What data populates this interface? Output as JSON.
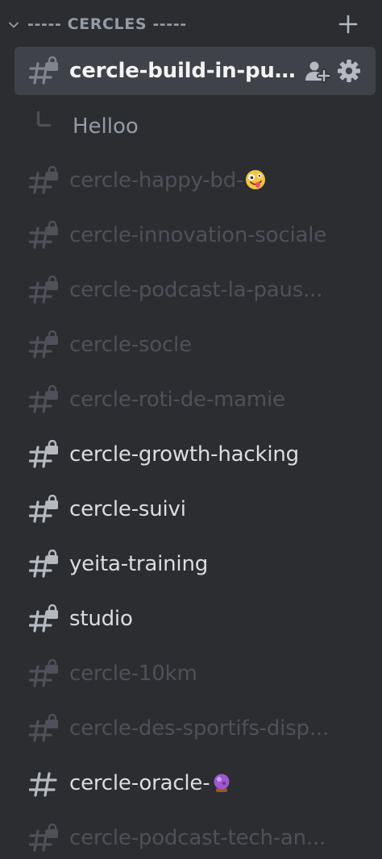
{
  "category": {
    "label": "----- CERCLES -----",
    "add_icon": "plus-icon",
    "collapse_icon": "chevron-down-icon"
  },
  "colors": {
    "background": "#2b2d31",
    "selected_bg": "#404249",
    "text_bright": "#dbdee1",
    "text_muted": "#4e5158",
    "text_selected": "#f2f3f5"
  },
  "channels": [
    {
      "name": "cercle-build-in-public",
      "display": "cercle-build-in-pu...",
      "state": "selected",
      "locked": true,
      "icon": "locked-text-channel-icon"
    },
    {
      "name": "cercle-happy-bd-",
      "state": "muted",
      "locked": true,
      "emoji": "zany-face"
    },
    {
      "name": "cercle-innovation-sociale",
      "state": "muted",
      "locked": true
    },
    {
      "name": "cercle-podcast-la-paus...",
      "state": "muted",
      "locked": true
    },
    {
      "name": "cercle-socle",
      "state": "muted",
      "locked": true
    },
    {
      "name": "cercle-roti-de-mamie",
      "state": "muted",
      "locked": true
    },
    {
      "name": "cercle-growth-hacking",
      "state": "bright",
      "locked": true
    },
    {
      "name": "cercle-suivi",
      "state": "bright",
      "locked": true
    },
    {
      "name": "yeita-training",
      "state": "bright",
      "locked": true
    },
    {
      "name": "studio",
      "state": "bright",
      "locked": true
    },
    {
      "name": "cercle-10km",
      "state": "muted",
      "locked": true
    },
    {
      "name": "cercle-des-sportifs-disp...",
      "state": "muted",
      "locked": true
    },
    {
      "name": "cercle-oracle-",
      "state": "bright",
      "locked": false,
      "emoji": "crystal-ball"
    },
    {
      "name": "cercle-podcast-tech-an...",
      "state": "muted",
      "locked": true
    }
  ],
  "thread": {
    "label": "Helloo",
    "icon": "thread-spine-icon"
  },
  "selected_actions": {
    "invite_icon": "create-invite-icon",
    "settings_icon": "gear-icon"
  }
}
